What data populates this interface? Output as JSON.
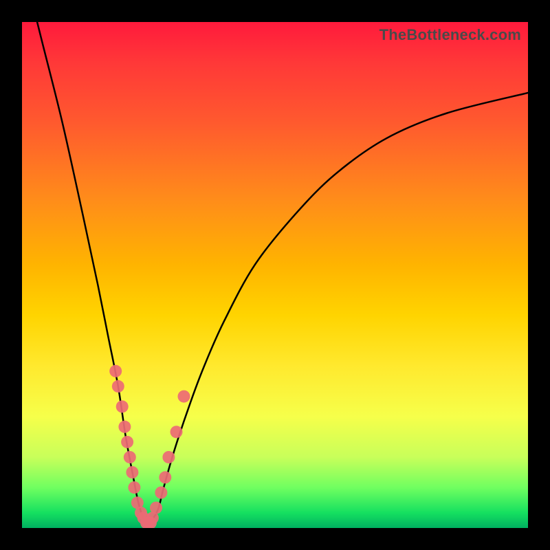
{
  "watermark": "TheBottleneck.com",
  "chart_data": {
    "type": "line",
    "title": "",
    "xlabel": "",
    "ylabel": "",
    "xlim": [
      0,
      100
    ],
    "ylim": [
      0,
      100
    ],
    "series": [
      {
        "name": "bottleneck-curve",
        "x": [
          0,
          4,
          8,
          12,
          15,
          17,
          19,
          20.5,
          22,
          23,
          24,
          25,
          26,
          27,
          28,
          30,
          33,
          36,
          40,
          46,
          54,
          62,
          72,
          84,
          100
        ],
        "y": [
          112,
          96,
          80,
          62,
          48,
          38,
          28,
          18,
          10,
          5,
          2,
          1,
          2,
          4,
          8,
          15,
          24,
          32,
          41,
          52,
          62,
          70,
          77,
          82,
          86
        ]
      }
    ],
    "markers": {
      "name": "sample-points",
      "x": [
        18.5,
        19.0,
        19.8,
        20.3,
        20.8,
        21.3,
        21.8,
        22.2,
        22.8,
        23.5,
        24.0,
        24.6,
        25.0,
        25.4,
        25.8,
        26.5,
        27.5,
        28.3,
        29.0,
        30.5,
        32.0
      ],
      "y": [
        31,
        28,
        24,
        20,
        17,
        14,
        11,
        8,
        5,
        3,
        2,
        1,
        1,
        1,
        2,
        4,
        7,
        10,
        14,
        19,
        26
      ],
      "color": "#ed6a75",
      "radius": 9
    },
    "background_gradient": {
      "top": "#ff1a3c",
      "mid": "#ffd400",
      "bottom": "#00b060"
    }
  }
}
